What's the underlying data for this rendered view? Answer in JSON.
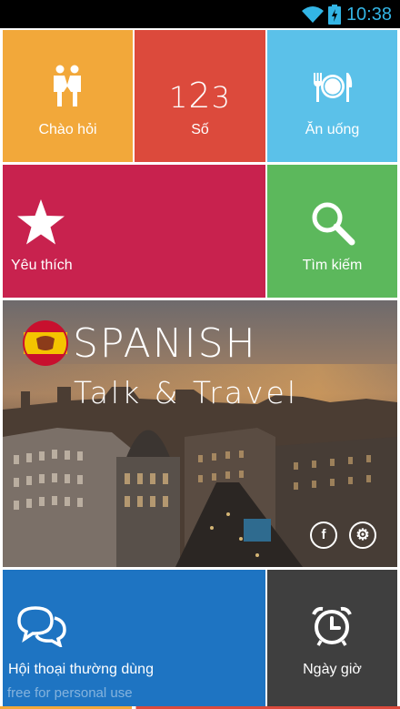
{
  "status_bar": {
    "time": "10:38",
    "icons": [
      "wifi-icon",
      "battery-charging-icon"
    ],
    "clock_color": "#33b5e5"
  },
  "tiles": {
    "greetings": {
      "label": "Chào hỏi",
      "icon": "people-icon",
      "color": "#f2a83a"
    },
    "numbers": {
      "label": "Số",
      "icon_text_a": "1",
      "icon_text_b": "2",
      "icon_text_c": "3",
      "color": "#dc4a3c"
    },
    "food": {
      "label": "Ăn uống",
      "icon": "fork-plate-knife-icon",
      "color": "#5bc1e9"
    },
    "favorites": {
      "label": "Yêu thích",
      "icon": "star-icon",
      "color": "#c8224e"
    },
    "search": {
      "label": "Tìm kiếm",
      "icon": "magnifier-icon",
      "color": "#5cb85c"
    },
    "phrases": {
      "label": "Hội thoại thường dùng",
      "icon": "chat-bubbles-icon",
      "color": "#1e74c2"
    },
    "datetime": {
      "label": "Ngày giờ",
      "icon": "alarm-clock-icon",
      "color": "#3f3f3f"
    }
  },
  "banner": {
    "title": "SPANISH",
    "subtitle": "Talk & Travel",
    "facebook_glyph": "f",
    "settings_glyph": "⚙",
    "watermark": "free for personal use"
  }
}
